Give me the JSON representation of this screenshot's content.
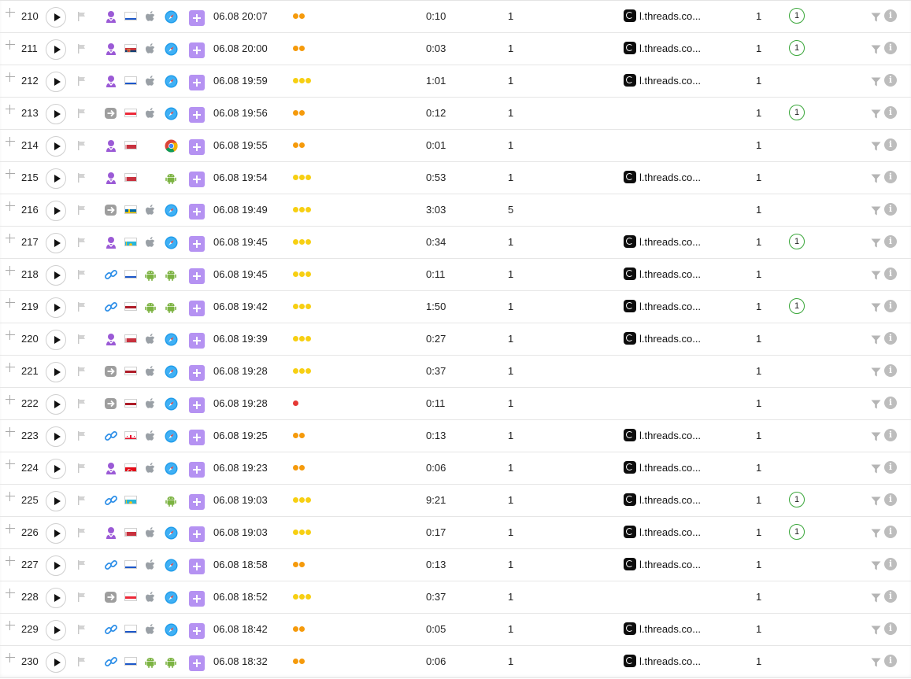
{
  "colors": {
    "accent_purple": "#b592f2",
    "dot_orange": "#f59a0b",
    "dot_yellow": "#f7cf12",
    "dot_red": "#e53935",
    "badge_green": "#3aa63a"
  },
  "info_glyph": "i",
  "rows": [
    {
      "num": "210",
      "src": "user-icon",
      "country": "ru",
      "os": "apple-icon",
      "browser": "safari-icon",
      "datetime": "06.08 20:07",
      "dots": "orange2",
      "duration": "0:10",
      "pages": "1",
      "ref": "l.threads.co...",
      "visits": "1",
      "badge": "1"
    },
    {
      "num": "211",
      "src": "user-icon",
      "country": "rs",
      "os": "apple-icon",
      "browser": "safari-icon",
      "datetime": "06.08 20:00",
      "dots": "orange2",
      "duration": "0:03",
      "pages": "1",
      "ref": "l.threads.co...",
      "visits": "1",
      "badge": "1"
    },
    {
      "num": "212",
      "src": "user-icon",
      "country": "ru",
      "os": "apple-icon",
      "browser": "safari-icon",
      "datetime": "06.08 19:59",
      "dots": "yellow3",
      "duration": "1:01",
      "pages": "1",
      "ref": "l.threads.co...",
      "visits": "1",
      "badge": ""
    },
    {
      "num": "213",
      "src": "direct-icon",
      "country": "at",
      "os": "apple-icon",
      "browser": "safari-icon",
      "datetime": "06.08 19:56",
      "dots": "orange2",
      "duration": "0:12",
      "pages": "1",
      "ref": "",
      "visits": "1",
      "badge": "1"
    },
    {
      "num": "214",
      "src": "user-icon",
      "country": "by",
      "os": "",
      "browser": "chrome-icon",
      "datetime": "06.08 19:55",
      "dots": "orange2",
      "duration": "0:01",
      "pages": "1",
      "ref": "",
      "visits": "1",
      "badge": ""
    },
    {
      "num": "215",
      "src": "user-icon",
      "country": "by",
      "os": "",
      "browser": "android-icon",
      "datetime": "06.08 19:54",
      "dots": "yellow3",
      "duration": "0:53",
      "pages": "1",
      "ref": "l.threads.co...",
      "visits": "1",
      "badge": ""
    },
    {
      "num": "216",
      "src": "direct-icon",
      "country": "se",
      "os": "apple-icon",
      "browser": "safari-icon",
      "datetime": "06.08 19:49",
      "dots": "yellow3",
      "duration": "3:03",
      "pages": "5",
      "ref": "",
      "visits": "1",
      "badge": ""
    },
    {
      "num": "217",
      "src": "user-icon",
      "country": "kz",
      "os": "apple-icon",
      "browser": "safari-icon",
      "datetime": "06.08 19:45",
      "dots": "yellow3",
      "duration": "0:34",
      "pages": "1",
      "ref": "l.threads.co...",
      "visits": "1",
      "badge": "1"
    },
    {
      "num": "218",
      "src": "link-icon",
      "country": "ru",
      "os": "android-icon",
      "browser": "android-icon",
      "datetime": "06.08 19:45",
      "dots": "yellow3",
      "duration": "0:11",
      "pages": "1",
      "ref": "l.threads.co...",
      "visits": "1",
      "badge": ""
    },
    {
      "num": "219",
      "src": "link-icon",
      "country": "nl",
      "os": "android-icon",
      "browser": "android-icon",
      "datetime": "06.08 19:42",
      "dots": "yellow3",
      "duration": "1:50",
      "pages": "1",
      "ref": "l.threads.co...",
      "visits": "1",
      "badge": "1"
    },
    {
      "num": "220",
      "src": "user-icon",
      "country": "by",
      "os": "apple-icon",
      "browser": "safari-icon",
      "datetime": "06.08 19:39",
      "dots": "yellow3",
      "duration": "0:27",
      "pages": "1",
      "ref": "l.threads.co...",
      "visits": "1",
      "badge": ""
    },
    {
      "num": "221",
      "src": "direct-icon",
      "country": "nl",
      "os": "apple-icon",
      "browser": "safari-icon",
      "datetime": "06.08 19:28",
      "dots": "yellow3",
      "duration": "0:37",
      "pages": "1",
      "ref": "",
      "visits": "1",
      "badge": ""
    },
    {
      "num": "222",
      "src": "direct-icon",
      "country": "nl",
      "os": "apple-icon",
      "browser": "safari-icon",
      "datetime": "06.08 19:28",
      "dots": "red1",
      "duration": "0:11",
      "pages": "1",
      "ref": "",
      "visits": "1",
      "badge": ""
    },
    {
      "num": "223",
      "src": "link-icon",
      "country": "ge",
      "os": "apple-icon",
      "browser": "safari-icon",
      "datetime": "06.08 19:25",
      "dots": "orange2",
      "duration": "0:13",
      "pages": "1",
      "ref": "l.threads.co...",
      "visits": "1",
      "badge": ""
    },
    {
      "num": "224",
      "src": "user-icon",
      "country": "tr",
      "os": "apple-icon",
      "browser": "safari-icon",
      "datetime": "06.08 19:23",
      "dots": "orange2",
      "duration": "0:06",
      "pages": "1",
      "ref": "l.threads.co...",
      "visits": "1",
      "badge": ""
    },
    {
      "num": "225",
      "src": "link-icon",
      "country": "kz",
      "os": "",
      "browser": "android-icon",
      "datetime": "06.08 19:03",
      "dots": "yellow3",
      "duration": "9:21",
      "pages": "1",
      "ref": "l.threads.co...",
      "visits": "1",
      "badge": "1"
    },
    {
      "num": "226",
      "src": "user-icon",
      "country": "by",
      "os": "apple-icon",
      "browser": "safari-icon",
      "datetime": "06.08 19:03",
      "dots": "yellow3",
      "duration": "0:17",
      "pages": "1",
      "ref": "l.threads.co...",
      "visits": "1",
      "badge": "1"
    },
    {
      "num": "227",
      "src": "link-icon",
      "country": "ru",
      "os": "apple-icon",
      "browser": "safari-icon",
      "datetime": "06.08 18:58",
      "dots": "orange2",
      "duration": "0:13",
      "pages": "1",
      "ref": "l.threads.co...",
      "visits": "1",
      "badge": ""
    },
    {
      "num": "228",
      "src": "direct-icon",
      "country": "at",
      "os": "apple-icon",
      "browser": "safari-icon",
      "datetime": "06.08 18:52",
      "dots": "yellow3",
      "duration": "0:37",
      "pages": "1",
      "ref": "",
      "visits": "1",
      "badge": ""
    },
    {
      "num": "229",
      "src": "link-icon",
      "country": "ru",
      "os": "apple-icon",
      "browser": "safari-icon",
      "datetime": "06.08 18:42",
      "dots": "orange2",
      "duration": "0:05",
      "pages": "1",
      "ref": "l.threads.co...",
      "visits": "1",
      "badge": ""
    },
    {
      "num": "230",
      "src": "link-icon",
      "country": "ru",
      "os": "android-icon",
      "browser": "android-icon",
      "datetime": "06.08 18:32",
      "dots": "orange2",
      "duration": "0:06",
      "pages": "1",
      "ref": "l.threads.co...",
      "visits": "1",
      "badge": ""
    }
  ]
}
